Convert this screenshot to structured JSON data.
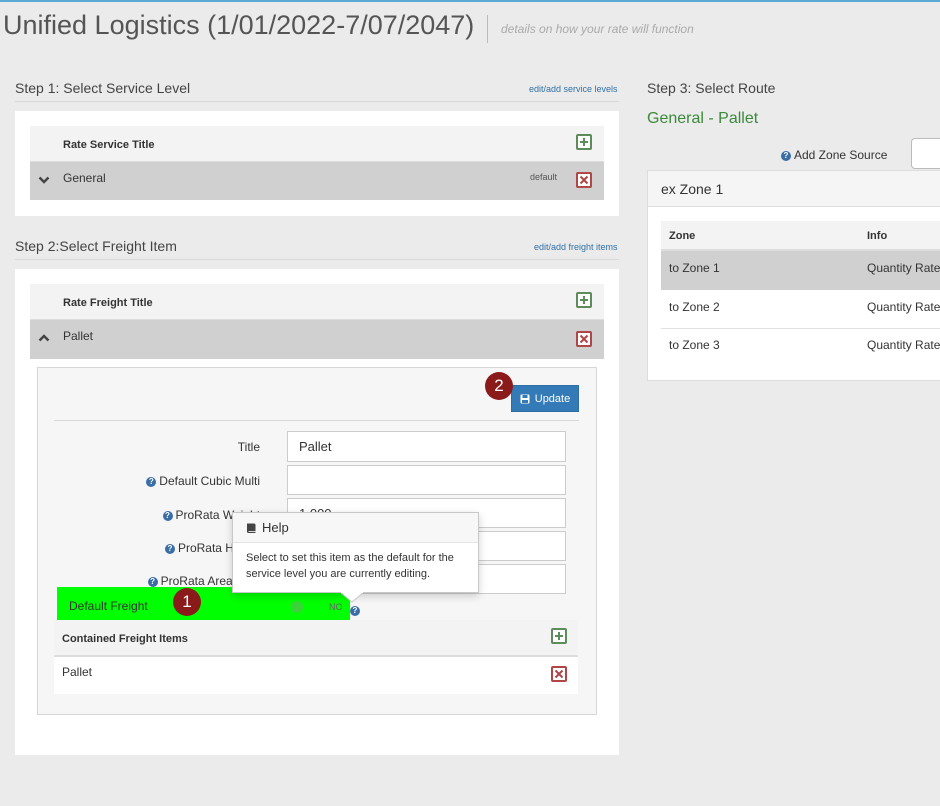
{
  "header": {
    "title": "Unified Logistics (1/01/2022-7/07/2047)",
    "subtitle": "details on how your rate will function"
  },
  "step1": {
    "heading": "Step 1: Select Service Level",
    "link": "edit/add service levels",
    "table": {
      "column_header": "Rate Service Title",
      "rows": [
        {
          "title": "General",
          "tag": "default"
        }
      ]
    }
  },
  "step2": {
    "heading": "Step 2:Select Freight Item",
    "link": "edit/add freight items",
    "table": {
      "column_header": "Rate Freight Title",
      "rows": [
        {
          "title": "Pallet"
        }
      ]
    },
    "editor": {
      "update_label": "Update",
      "badge_number": "2",
      "fields": [
        {
          "label": "Title",
          "value": "Pallet",
          "help": false
        },
        {
          "label": "Default Cubic Multi",
          "value": "",
          "help": true
        },
        {
          "label": "ProRata Weight",
          "value": "1.000",
          "help": true
        },
        {
          "label": "ProRata Height",
          "value": "",
          "help": true
        },
        {
          "label": "ProRata Area LxW",
          "value": "",
          "help": true
        }
      ],
      "default_freight": {
        "label": "Default Freight",
        "badge_number": "1",
        "toggle_state": "NO"
      },
      "contained": {
        "header": "Contained Freight Items",
        "items": [
          "Pallet"
        ]
      }
    },
    "popover": {
      "title": "Help",
      "body": "Select to set this item as the default for the service level you are currently editing."
    }
  },
  "step3": {
    "heading": "Step 3: Select Route",
    "route": "General - Pallet",
    "add_zone_source_label": "Add Zone Source",
    "zone_panel": {
      "title": "ex Zone 1",
      "columns": [
        "Zone",
        "Info"
      ],
      "rows": [
        {
          "zone": "to Zone 1",
          "info": "Quantity Rates"
        },
        {
          "zone": "to Zone 2",
          "info": "Quantity Rates"
        },
        {
          "zone": "to Zone 3",
          "info": "Quantity Rates"
        }
      ]
    }
  },
  "colors": {
    "accent_blue": "#337ab7",
    "highlight_green": "#00ff00",
    "badge_red": "#8b1a1a",
    "route_green": "#3b8a3b"
  }
}
